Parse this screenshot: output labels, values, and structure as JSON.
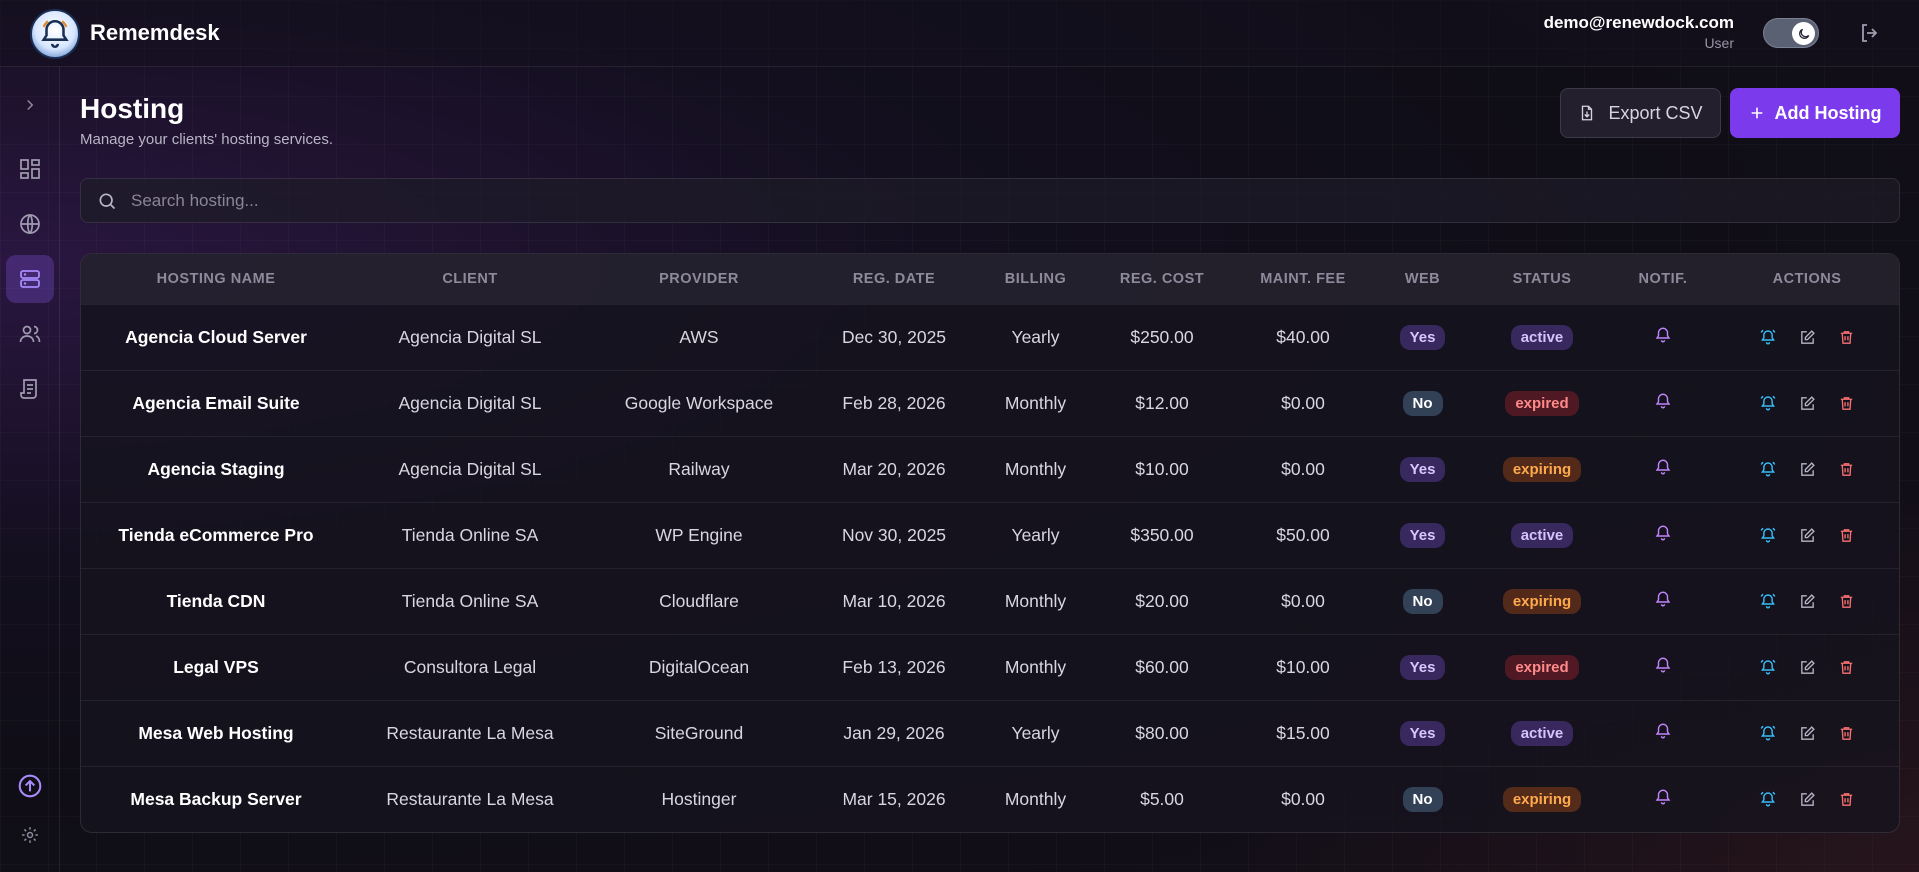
{
  "app": {
    "name": "Rememdesk"
  },
  "user": {
    "email": "demo@renewdock.com",
    "role": "User"
  },
  "page": {
    "title": "Hosting",
    "subtitle": "Manage your clients' hosting services.",
    "export_label": "Export CSV",
    "add_label": "Add Hosting"
  },
  "search": {
    "placeholder": "Search hosting..."
  },
  "table": {
    "columns": [
      "Hosting Name",
      "Client",
      "Provider",
      "Reg. Date",
      "Billing",
      "Reg. Cost",
      "Maint. Fee",
      "Web",
      "Status",
      "Notif.",
      "Actions"
    ],
    "rows": [
      {
        "name": "Agencia Cloud Server",
        "client": "Agencia Digital SL",
        "provider": "AWS",
        "reg_date": "Dec 30, 2025",
        "billing": "Yearly",
        "reg_cost": "$250.00",
        "maint_fee": "$40.00",
        "web": "Yes",
        "status": "active"
      },
      {
        "name": "Agencia Email Suite",
        "client": "Agencia Digital SL",
        "provider": "Google Workspace",
        "reg_date": "Feb 28, 2026",
        "billing": "Monthly",
        "reg_cost": "$12.00",
        "maint_fee": "$0.00",
        "web": "No",
        "status": "expired"
      },
      {
        "name": "Agencia Staging",
        "client": "Agencia Digital SL",
        "provider": "Railway",
        "reg_date": "Mar 20, 2026",
        "billing": "Monthly",
        "reg_cost": "$10.00",
        "maint_fee": "$0.00",
        "web": "Yes",
        "status": "expiring"
      },
      {
        "name": "Tienda eCommerce Pro",
        "client": "Tienda Online SA",
        "provider": "WP Engine",
        "reg_date": "Nov 30, 2025",
        "billing": "Yearly",
        "reg_cost": "$350.00",
        "maint_fee": "$50.00",
        "web": "Yes",
        "status": "active"
      },
      {
        "name": "Tienda CDN",
        "client": "Tienda Online SA",
        "provider": "Cloudflare",
        "reg_date": "Mar 10, 2026",
        "billing": "Monthly",
        "reg_cost": "$20.00",
        "maint_fee": "$0.00",
        "web": "No",
        "status": "expiring"
      },
      {
        "name": "Legal VPS",
        "client": "Consultora Legal",
        "provider": "DigitalOcean",
        "reg_date": "Feb 13, 2026",
        "billing": "Monthly",
        "reg_cost": "$60.00",
        "maint_fee": "$10.00",
        "web": "Yes",
        "status": "expired"
      },
      {
        "name": "Mesa Web Hosting",
        "client": "Restaurante La Mesa",
        "provider": "SiteGround",
        "reg_date": "Jan 29, 2026",
        "billing": "Yearly",
        "reg_cost": "$80.00",
        "maint_fee": "$15.00",
        "web": "Yes",
        "status": "active"
      },
      {
        "name": "Mesa Backup Server",
        "client": "Restaurante La Mesa",
        "provider": "Hostinger",
        "reg_date": "Mar 15, 2026",
        "billing": "Monthly",
        "reg_cost": "$5.00",
        "maint_fee": "$0.00",
        "web": "No",
        "status": "expiring"
      }
    ]
  },
  "icons": {
    "sidebar": [
      "chevron-right-icon",
      "dashboard-icon",
      "globe-icon",
      "server-icon",
      "users-icon",
      "receipt-icon",
      "upgrade-icon",
      "gear-icon"
    ],
    "row_actions": [
      "bell-ring-icon",
      "edit-icon",
      "trash-icon"
    ]
  },
  "colors": {
    "accent": "#7c3aed",
    "notif": "#c084fc",
    "action_bell": "#38bdf8",
    "delete": "#f87171"
  }
}
